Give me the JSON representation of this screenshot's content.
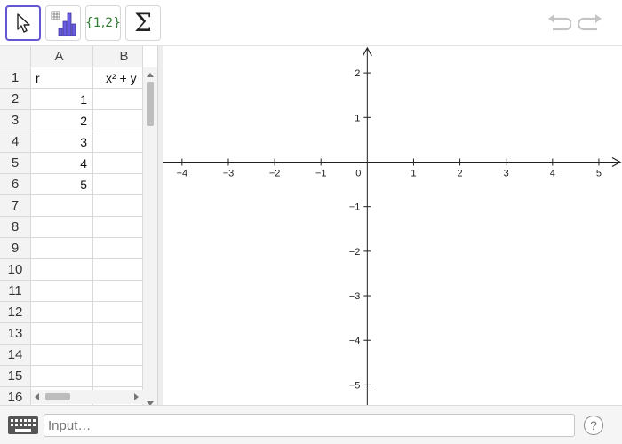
{
  "toolbar": {
    "tools": [
      {
        "name": "move",
        "icon": "cursor-arrow-icon"
      },
      {
        "name": "one-variable-analysis",
        "icon": "bar-chart-icon"
      },
      {
        "name": "create-list",
        "label": "{1,2}"
      },
      {
        "name": "sum",
        "label": "Σ"
      }
    ],
    "undo_icon": "undo-icon",
    "redo_icon": "redo-icon",
    "accent_color": "#6557d2"
  },
  "spreadsheet": {
    "columns": [
      "A",
      "B"
    ],
    "rows": [
      {
        "n": "1",
        "a": "r",
        "b": "x² + y"
      },
      {
        "n": "2",
        "a": "1",
        "b": ""
      },
      {
        "n": "3",
        "a": "2",
        "b": ""
      },
      {
        "n": "4",
        "a": "3",
        "b": ""
      },
      {
        "n": "5",
        "a": "4",
        "b": ""
      },
      {
        "n": "6",
        "a": "5",
        "b": ""
      },
      {
        "n": "7",
        "a": "",
        "b": ""
      },
      {
        "n": "8",
        "a": "",
        "b": ""
      },
      {
        "n": "9",
        "a": "",
        "b": ""
      },
      {
        "n": "10",
        "a": "",
        "b": ""
      },
      {
        "n": "11",
        "a": "",
        "b": ""
      },
      {
        "n": "12",
        "a": "",
        "b": ""
      },
      {
        "n": "13",
        "a": "",
        "b": ""
      },
      {
        "n": "14",
        "a": "",
        "b": ""
      },
      {
        "n": "15",
        "a": "",
        "b": ""
      },
      {
        "n": "16",
        "a": "",
        "b": ""
      }
    ]
  },
  "graphics": {
    "x_ticks": [
      "−4",
      "−3",
      "−2",
      "−1",
      "0",
      "1",
      "2",
      "3",
      "4",
      "5"
    ],
    "y_ticks": [
      "2",
      "1",
      "−1",
      "−2",
      "−3",
      "−4",
      "−5"
    ],
    "xlim": [
      -4.4,
      5.5
    ],
    "ylim": [
      -5.45,
      2.6
    ]
  },
  "inputbar": {
    "placeholder": "Input…",
    "keyboard_icon": "keyboard-icon",
    "help_label": "?"
  }
}
